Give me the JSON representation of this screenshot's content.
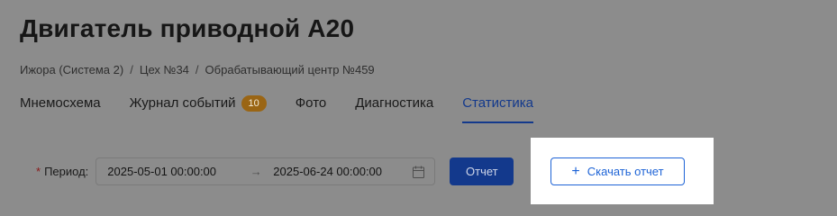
{
  "header": {
    "title": "Двигатель приводной А20"
  },
  "breadcrumb": {
    "items": [
      "Ижора (Система 2)",
      "Цех №34",
      "Обрабатывающий центр №459"
    ],
    "separator": "/"
  },
  "tabs": [
    {
      "label": "Мнемосхема",
      "active": false
    },
    {
      "label": "Журнал событий",
      "badge": "10",
      "active": false
    },
    {
      "label": "Фото",
      "active": false
    },
    {
      "label": "Диагностика",
      "active": false
    },
    {
      "label": "Статистика",
      "active": true
    }
  ],
  "filter": {
    "required_mark": "*",
    "period_label": "Период",
    "colon": ":",
    "start": "2025-05-01 00:00:00",
    "arrow": "→",
    "end": "2025-06-24 00:00:00",
    "calendar_icon": "calendar-icon"
  },
  "actions": {
    "report_label": "Отчет",
    "download_label": "Скачать отчет",
    "download_icon": "plus-icon",
    "download_plus": "+"
  },
  "colors": {
    "primary": "#1d63d6",
    "badge": "#faad14"
  }
}
